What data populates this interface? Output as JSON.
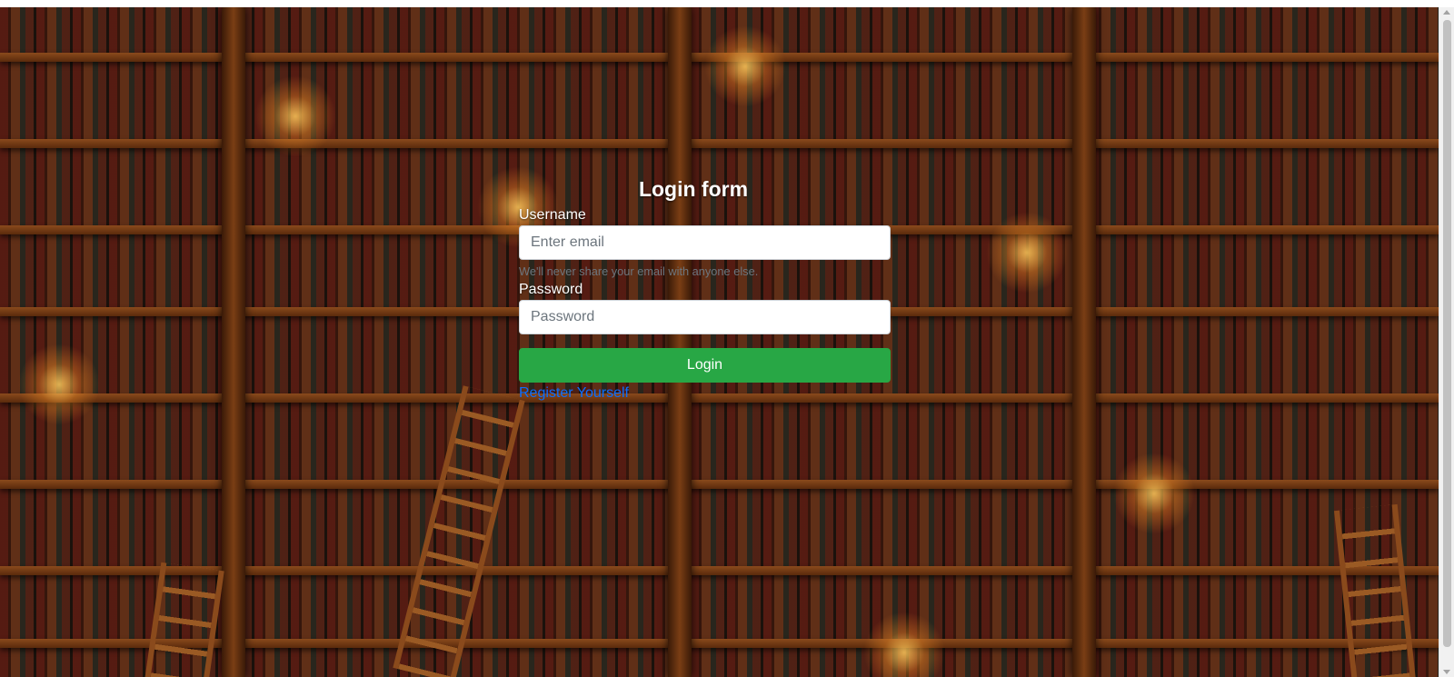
{
  "form": {
    "title": "Login form",
    "username_label": "Username",
    "username_placeholder": "Enter email",
    "username_help": "We'll never share your email with anyone else.",
    "password_label": "Password",
    "password_placeholder": "Password",
    "login_button": "Login",
    "register_link": "Register Yourself"
  },
  "colors": {
    "login_button": "#28a745",
    "register_link": "#0d6efd",
    "help_text": "#6c757d"
  },
  "background": {
    "description_icon": "library-bookshelf-image"
  }
}
